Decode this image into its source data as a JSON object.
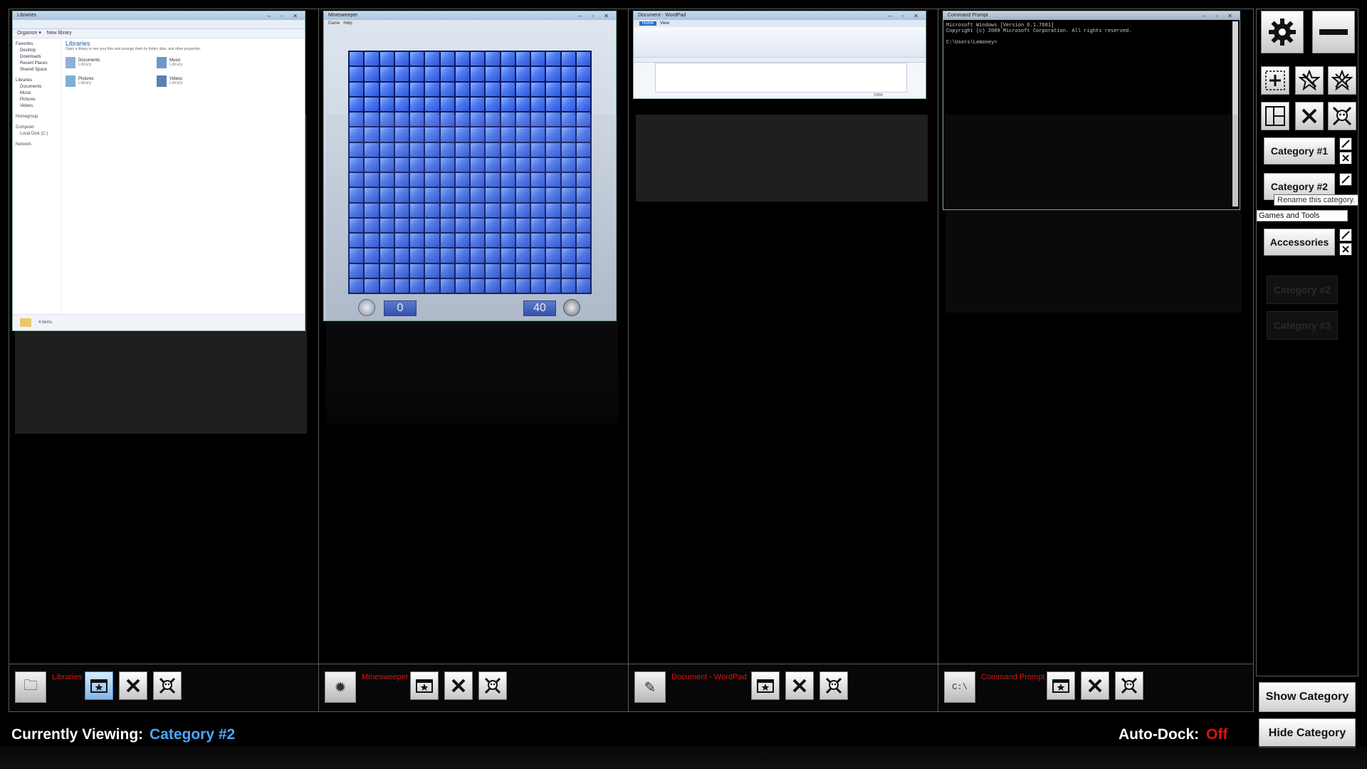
{
  "columns": [
    {
      "app_name": "Libraries",
      "icon": "folder-icon"
    },
    {
      "app_name": "Minesweeper",
      "icon": "minesweeper-icon"
    },
    {
      "app_name": "Document - WordPad",
      "icon": "wordpad-icon"
    },
    {
      "app_name": "Command Prompt",
      "icon": "cmd-icon"
    }
  ],
  "explorer": {
    "title": "Libraries",
    "toolbar": [
      "Organize ▾",
      "New library"
    ],
    "heading": "Libraries",
    "subheading": "Open a library to see your files and arrange them by folder, date, and other properties.",
    "nav": [
      "Favorites",
      "Desktop",
      "Downloads",
      "Recent Places",
      "Shared Space",
      "Libraries",
      "Documents",
      "Music",
      "Pictures",
      "Videos",
      "Homegroup",
      "Computer",
      "Local Disk (C:)",
      "Network"
    ],
    "items": [
      "Documents",
      "Music",
      "Pictures",
      "Videos"
    ],
    "item_sub": "Library",
    "status": "4 items"
  },
  "minesweeper": {
    "title": "Minesweeper",
    "menu": [
      "Game",
      "Help"
    ],
    "time": "0",
    "mines": "40"
  },
  "wordpad": {
    "title": "Document - WordPad",
    "tabs": [
      "Home",
      "View"
    ],
    "zoom": "100%"
  },
  "cmd": {
    "title": "Command Prompt",
    "lines": [
      "Microsoft Windows [Version 6.1.7601]",
      "Copyright (c) 2009 Microsoft Corporation.  All rights reserved.",
      "",
      "C:\\Users\\Lemoney>"
    ]
  },
  "right_panel": {
    "categories": [
      "Category #1",
      "Category #2",
      "Accessories"
    ],
    "ghost_categories": [
      "Category #2",
      "Category #3"
    ],
    "tooltip": "Rename this category.",
    "rename_input": "Games and Tools",
    "show_category": "Show Category",
    "hide_category": "Hide Category"
  },
  "status_bar": {
    "viewing_label": "Currently Viewing:",
    "viewing_value": "Category #2",
    "autodock_label": "Auto-Dock:",
    "autodock_value": "Off"
  },
  "colors": {
    "accent_blue": "#4da6ff",
    "accent_red": "#e01010"
  }
}
